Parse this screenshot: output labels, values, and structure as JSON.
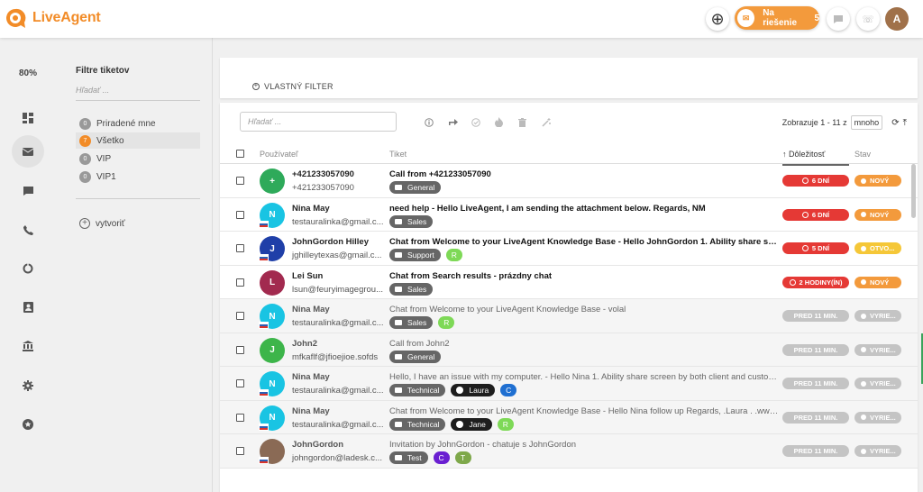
{
  "app": {
    "logo_text": "LiveAgent",
    "status_label": "Na riešenie",
    "status_count": "5",
    "avatar_initial": "A",
    "brand_color": "#f28c28"
  },
  "nav": {
    "zoom": "80%",
    "icons": [
      "dashboard-icon",
      "mail-icon",
      "chat-icon",
      "phone-icon",
      "reports-icon",
      "contacts-icon",
      "bank-icon",
      "settings-icon",
      "star-icon"
    ]
  },
  "filters": {
    "title": "Filtre tiketov",
    "search_placeholder": "Hľadať ...",
    "items": [
      {
        "count": "0",
        "label": "Priradené mne"
      },
      {
        "count": "7",
        "label": "Všetko"
      },
      {
        "count": "0",
        "label": "VIP"
      },
      {
        "count": "0",
        "label": "VIP1"
      }
    ],
    "create_label": "vytvoriť"
  },
  "toolbar": {
    "custom_filter": "VLASTNÝ FILTER",
    "search_placeholder": "Hľadať ...",
    "pager_text": "Zobrazuje 1 - 11 z",
    "pager_many": "mnoho"
  },
  "table": {
    "headers": {
      "user": "Používateľ",
      "ticket": "Tiket",
      "priority": "Dôležitosť",
      "state": "Stav"
    },
    "rows": [
      {
        "avatar": "+",
        "avatar_color": "#2eaa5a",
        "flag": false,
        "name": "+421233057090",
        "email": "+421233057090",
        "subject": "Call from +421233057090",
        "tags": [
          {
            "kind": "dept",
            "label": "General"
          }
        ],
        "priority": "6 DNÍ",
        "priority_style": "red",
        "state": "NOVÝ",
        "state_style": "orange",
        "read": false
      },
      {
        "avatar": "N",
        "avatar_color": "#19c4e3",
        "flag": true,
        "name": "Nina May",
        "email": "testauralinka@gmail.c...",
        "subject": "need help - Hello LiveAgent, I am sending the attachment below. Regards, NM",
        "tags": [
          {
            "kind": "dept",
            "label": "Sales"
          }
        ],
        "priority": "6 DNÍ",
        "priority_style": "red",
        "state": "NOVÝ",
        "state_style": "orange",
        "read": false
      },
      {
        "avatar": "J",
        "avatar_color": "#1f3fa8",
        "flag": true,
        "name": "JohnGordon Hilley",
        "email": "jghilleytexas@gmail.c...",
        "subject": "Chat from Welcome to your LiveAgent Knowledge Base - Hello JohnGordon 1. Ability share screen b...",
        "tags": [
          {
            "kind": "dept",
            "label": "Support"
          },
          {
            "kind": "circle",
            "label": "R",
            "color": "#7ed957"
          }
        ],
        "priority": "5 DNÍ",
        "priority_style": "red",
        "state": "OTVO...",
        "state_style": "yellow",
        "read": false
      },
      {
        "avatar": "L",
        "avatar_color": "#a22a4f",
        "flag": false,
        "name": "Lei Sun",
        "email": "lsun@feuryimagegrou...",
        "subject": "Chat from Search results - prázdny chat",
        "tags": [
          {
            "kind": "dept",
            "label": "Sales"
          }
        ],
        "priority": "2 HODINY(ÍN)",
        "priority_style": "red",
        "state": "NOVÝ",
        "state_style": "orange",
        "read": false
      },
      {
        "avatar": "N",
        "avatar_color": "#19c4e3",
        "flag": true,
        "name": "Nina May",
        "email": "testauralinka@gmail.c...",
        "subject": "Chat from Welcome to your LiveAgent Knowledge Base - volal",
        "tags": [
          {
            "kind": "dept",
            "label": "Sales"
          },
          {
            "kind": "circle",
            "label": "R",
            "color": "#7ed957"
          }
        ],
        "priority": "PRED 11 MIN.",
        "priority_style": "grey",
        "state": "VYRIE...",
        "state_style": "grey",
        "read": true
      },
      {
        "avatar": "J",
        "avatar_color": "#3db54a",
        "flag": false,
        "name": "John2",
        "email": "mfkaflf@jfioejioe.sofds",
        "subject": "Call from John2",
        "tags": [
          {
            "kind": "dept",
            "label": "General"
          }
        ],
        "priority": "PRED 11 MIN.",
        "priority_style": "grey",
        "state": "VYRIE...",
        "state_style": "grey",
        "read": true
      },
      {
        "avatar": "N",
        "avatar_color": "#19c4e3",
        "flag": true,
        "name": "Nina May",
        "email": "testauralinka@gmail.c...",
        "subject": "Hello, I have an issue with my computer. - Hello Nina 1. Ability share screen by both client and custom...",
        "tags": [
          {
            "kind": "dept",
            "label": "Technical"
          },
          {
            "kind": "agent",
            "label": "Laura"
          },
          {
            "kind": "circle",
            "label": "C",
            "color": "#1f6fd1"
          }
        ],
        "priority": "PRED 11 MIN.",
        "priority_style": "grey",
        "state": "VYRIE...",
        "state_style": "grey",
        "read": true
      },
      {
        "avatar": "N",
        "avatar_color": "#19c4e3",
        "flag": true,
        "name": "Nina May",
        "email": "testauralinka@gmail.c...",
        "subject": "Chat from Welcome to your LiveAgent Knowledge Base - Hello Nina follow up Regards, .Laura . .www.li...",
        "tags": [
          {
            "kind": "dept",
            "label": "Technical"
          },
          {
            "kind": "agent",
            "label": "Jane"
          },
          {
            "kind": "circle",
            "label": "R",
            "color": "#7ed957"
          }
        ],
        "priority": "PRED 11 MIN.",
        "priority_style": "grey",
        "state": "VYRIE...",
        "state_style": "grey",
        "read": true
      },
      {
        "avatar": "",
        "avatar_color": "#8a6a55",
        "flag": true,
        "name": "JohnGordon",
        "email": "johngordon@ladesk.c...",
        "subject": "Invitation by JohnGordon - chatuje s JohnGordon",
        "tags": [
          {
            "kind": "dept",
            "label": "Test"
          },
          {
            "kind": "circle",
            "label": "C",
            "color": "#6a1fd1"
          },
          {
            "kind": "circle",
            "label": "T",
            "color": "#7ea84a"
          }
        ],
        "priority": "PRED 11 MIN.",
        "priority_style": "grey",
        "state": "VYRIE...",
        "state_style": "grey",
        "read": true
      }
    ]
  }
}
